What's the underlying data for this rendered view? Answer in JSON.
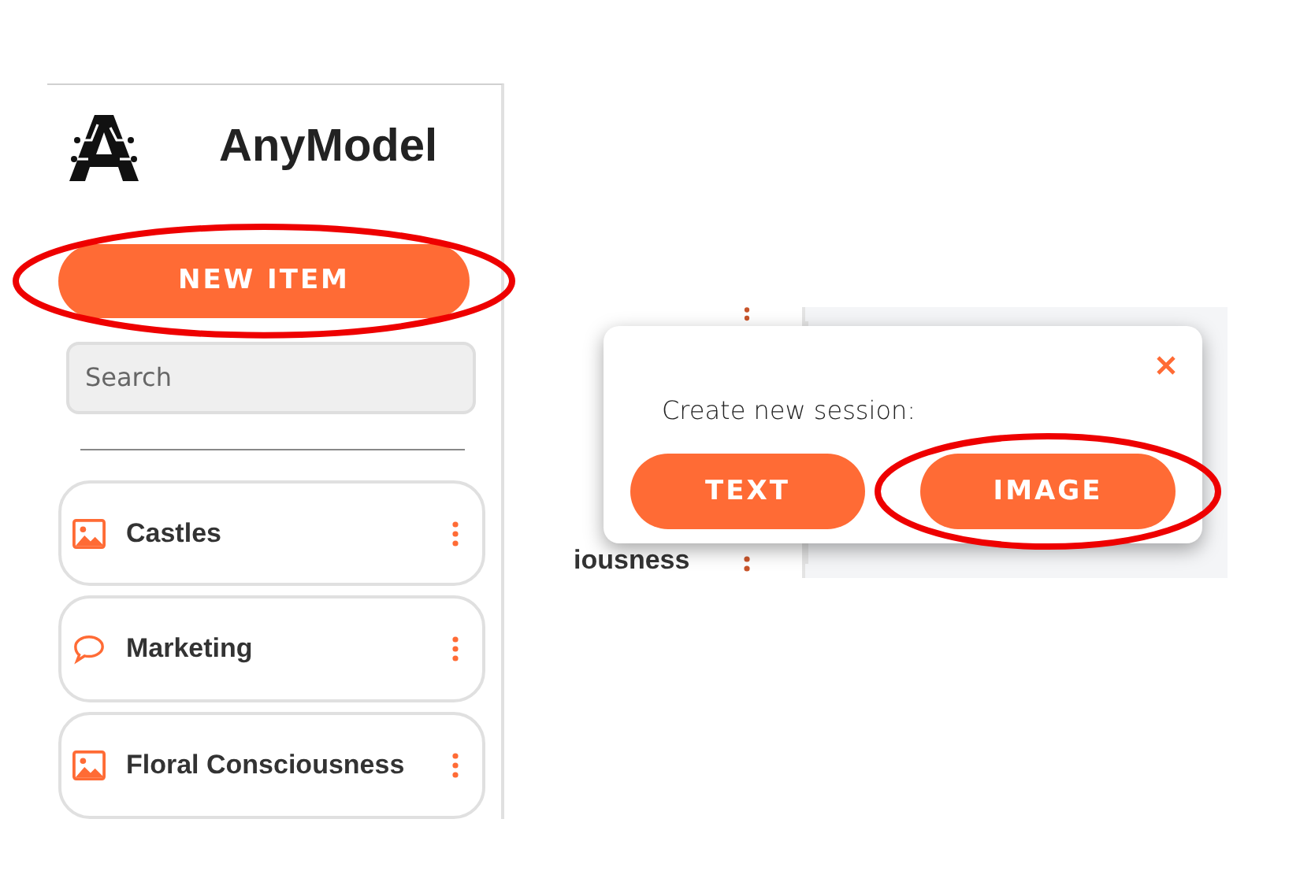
{
  "app": {
    "title": "AnyModel"
  },
  "new_item_button": {
    "label": "NEW ITEM",
    "highlighted": true
  },
  "search": {
    "placeholder": "Search"
  },
  "sessions": [
    {
      "kind": "image",
      "title": "Castles"
    },
    {
      "kind": "chat",
      "title": "Marketing"
    },
    {
      "kind": "image",
      "title": "Floral Consciousness"
    }
  ],
  "background_fragment": {
    "text": "iousness"
  },
  "dialog": {
    "message": "Create new session:",
    "buttons": [
      {
        "label": "TEXT",
        "highlighted": false
      },
      {
        "label": "IMAGE",
        "highlighted": true
      }
    ]
  }
}
